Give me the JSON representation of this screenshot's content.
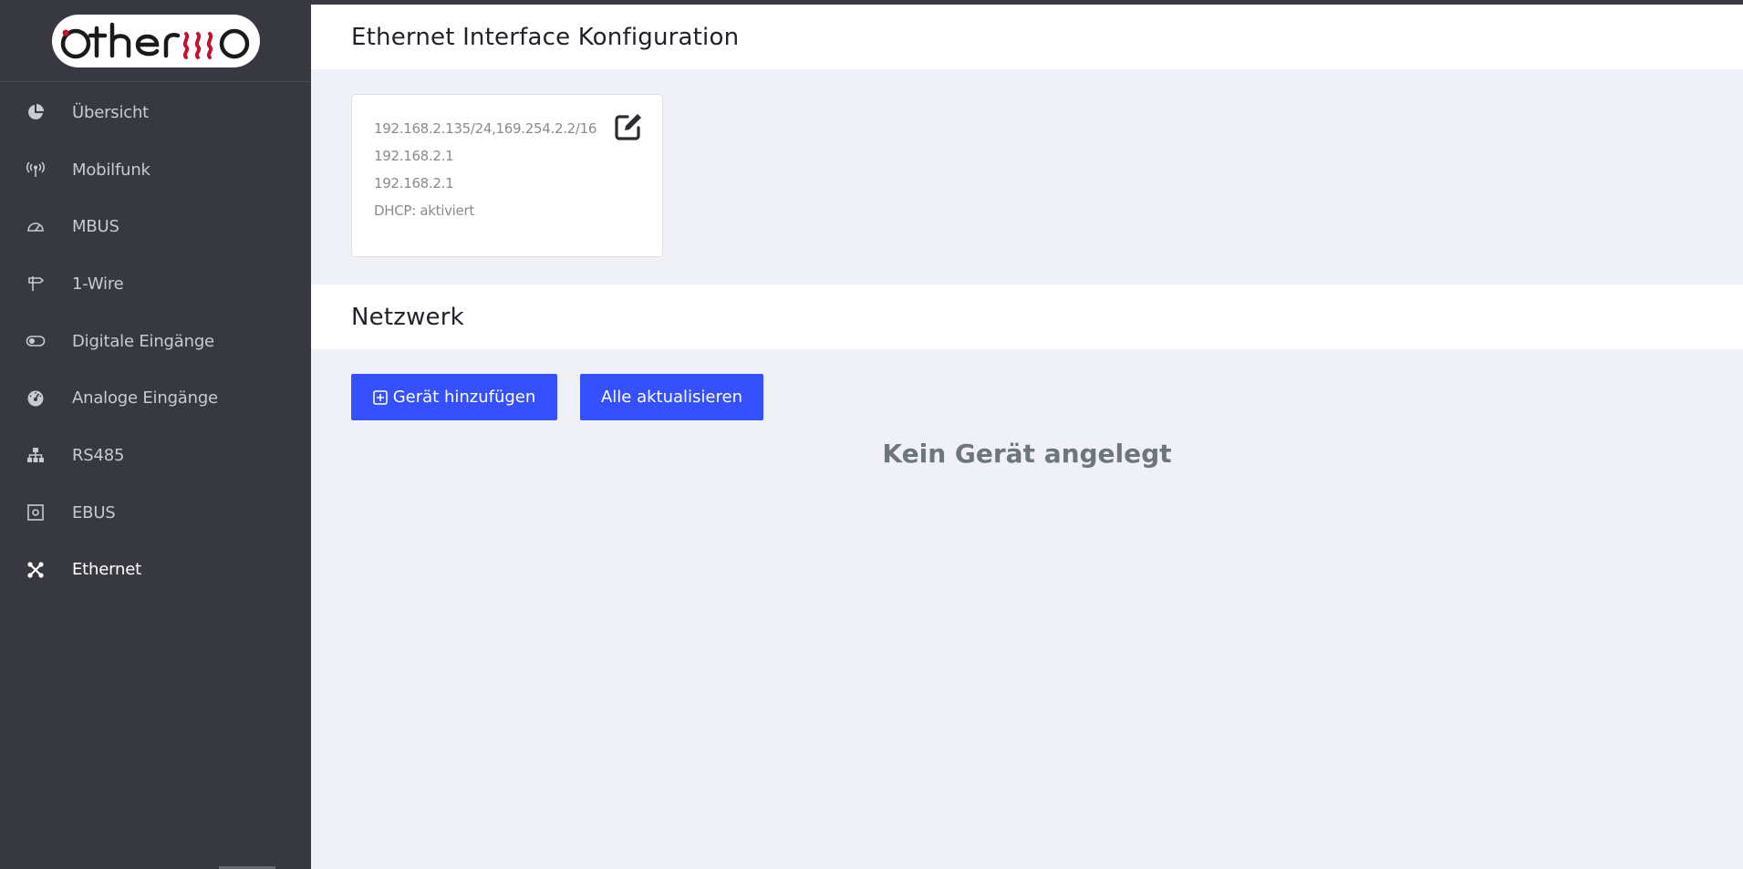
{
  "logo": {
    "text": "othermo",
    "accent_color": "#c8102e"
  },
  "sidebar": {
    "items": [
      {
        "label": "Übersicht",
        "icon": "pie-chart-icon",
        "active": false
      },
      {
        "label": "Mobilfunk",
        "icon": "antenna-icon",
        "active": false
      },
      {
        "label": "MBUS",
        "icon": "gauge-icon",
        "active": false
      },
      {
        "label": "1-Wire",
        "icon": "signpost-icon",
        "active": false
      },
      {
        "label": "Digitale Eingänge",
        "icon": "toggle-icon",
        "active": false
      },
      {
        "label": "Analoge Eingänge",
        "icon": "dial-icon",
        "active": false
      },
      {
        "label": "RS485",
        "icon": "sitemap-icon",
        "active": false
      },
      {
        "label": "EBUS",
        "icon": "chip-icon",
        "active": false
      },
      {
        "label": "Ethernet",
        "icon": "ethernet-icon",
        "active": true
      }
    ]
  },
  "ethernet": {
    "title": "Ethernet Interface Konfiguration",
    "address": "192.168.2.135/24,169.254.2.2/16",
    "gateway": "192.168.2.1",
    "dns": "192.168.2.1",
    "dhcp": "DHCP: aktiviert"
  },
  "network": {
    "title": "Netzwerk",
    "add_button": "Gerät hinzufügen",
    "refresh_button": "Alle aktualisieren",
    "empty_message": "Kein Gerät angelegt"
  },
  "colors": {
    "sidebar_bg": "#383840",
    "main_bg": "#f0f1f6",
    "button": "#3450ff"
  }
}
